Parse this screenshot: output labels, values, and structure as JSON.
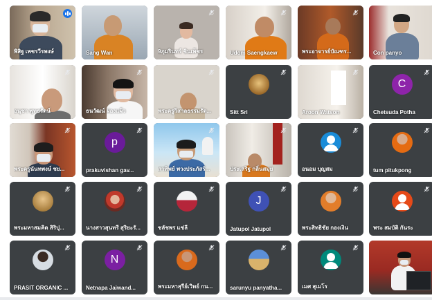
{
  "app_title": "",
  "participants": [
    {
      "name": "พิสิฐ เพชรวีรพงษ์",
      "avatar_kind": "video",
      "palette": "office",
      "mic": "speaking",
      "active": true
    },
    {
      "name": "Sang Wan",
      "avatar_kind": "video",
      "palette": "monk",
      "mic": "on"
    },
    {
      "name": "9ภุมรินทร์ ชินเพ็ชร",
      "avatar_kind": "video",
      "palette": "woman-wall",
      "mic": "muted"
    },
    {
      "name": "Udom Saengkaew",
      "avatar_kind": "video",
      "palette": "monk-room",
      "mic": "muted"
    },
    {
      "name": "พระอาจารย์บัณฑร...",
      "avatar_kind": "video",
      "palette": "monk-altar",
      "mic": "muted"
    },
    {
      "name": "Con panyo",
      "avatar_kind": "video",
      "palette": "pray",
      "mic": "on"
    },
    {
      "name": "อนุชา พุทธรัตน์",
      "avatar_kind": "video",
      "palette": "face-near",
      "mic": "muted"
    },
    {
      "name": "ธนวัฒน์ ผ่องแผ้ว",
      "avatar_kind": "video",
      "palette": "woman-mask",
      "mic": "muted"
    },
    {
      "name": "พระครูวิสาลธรรมรัต...",
      "avatar_kind": "video",
      "palette": "wall-monk",
      "mic": "muted"
    },
    {
      "name": "Sitt Sri",
      "avatar_kind": "photo",
      "palette": "coin",
      "mic": "muted"
    },
    {
      "name": "Aroon Watson",
      "avatar_kind": "video",
      "palette": "wall-window",
      "mic": "muted"
    },
    {
      "name": "Chetsuda Potha",
      "avatar_kind": "letter",
      "letter": "C",
      "color": "#8e24aa",
      "mic": "muted"
    },
    {
      "name": "พระครูนันทพงษ์ ชย...",
      "avatar_kind": "video",
      "palette": "curtain-mask",
      "mic": "muted"
    },
    {
      "name": "prakuvishan gav...",
      "avatar_kind": "letter",
      "letter": "p",
      "color": "#6a1b9a",
      "mic": "muted"
    },
    {
      "name": "สาทิพย์ พวงประภัสร์...",
      "avatar_kind": "video",
      "palette": "sky-mask",
      "mic": "muted"
    },
    {
      "name": "ประเสริฐ กลิ่นสมุย",
      "avatar_kind": "video",
      "palette": "monk-seat",
      "mic": "muted"
    },
    {
      "name": "อนอม บุญสม",
      "avatar_kind": "generic",
      "color": "#1a8cd8",
      "mic": "muted"
    },
    {
      "name": "tum pitukpong",
      "avatar_kind": "photo",
      "palette": "orange-monk",
      "mic": "muted"
    },
    {
      "name": "พระมหาสมคิด สิริปุ...",
      "avatar_kind": "photo",
      "palette": "statue",
      "mic": "muted"
    },
    {
      "name": "นางสาวสุนทรี สุริยะรั...",
      "avatar_kind": "photo",
      "palette": "girl",
      "mic": "muted"
    },
    {
      "name": "ชลัชพร แซ่ลี",
      "avatar_kind": "photo",
      "palette": "stage",
      "mic": "muted"
    },
    {
      "name": "Jatupol Jatupol",
      "avatar_kind": "letter",
      "letter": "J",
      "color": "#3f51b5",
      "mic": "muted"
    },
    {
      "name": "พระสิทธิชัย กองเงิน",
      "avatar_kind": "photo",
      "palette": "orange-monk2",
      "mic": "muted"
    },
    {
      "name": "พระ สมบัติ กันระ",
      "avatar_kind": "generic",
      "color": "#e64a19",
      "mic": "muted"
    },
    {
      "name": "PRASIT ORGANIC ...",
      "avatar_kind": "photo",
      "palette": "black-man",
      "mic": "muted"
    },
    {
      "name": "Netnapa Jaiwand...",
      "avatar_kind": "letter",
      "letter": "N",
      "color": "#7b1fa2",
      "mic": "muted"
    },
    {
      "name": "พระมหาสุรีย์เวิทย์ กน...",
      "avatar_kind": "photo",
      "palette": "orange-monk3",
      "mic": "muted"
    },
    {
      "name": "sarunyu panyatha...",
      "avatar_kind": "photo",
      "palette": "temple",
      "mic": "muted"
    },
    {
      "name": "เมศ สุเมโร",
      "avatar_kind": "generic",
      "color": "#00897b",
      "mic": "muted"
    },
    {
      "name": "",
      "avatar_kind": "video",
      "palette": "presenter",
      "mic": "none"
    }
  ],
  "icons": {
    "muted": "mic-off-icon",
    "on": "mic-on-icon",
    "speaking": "speaking-indicator-icon"
  }
}
